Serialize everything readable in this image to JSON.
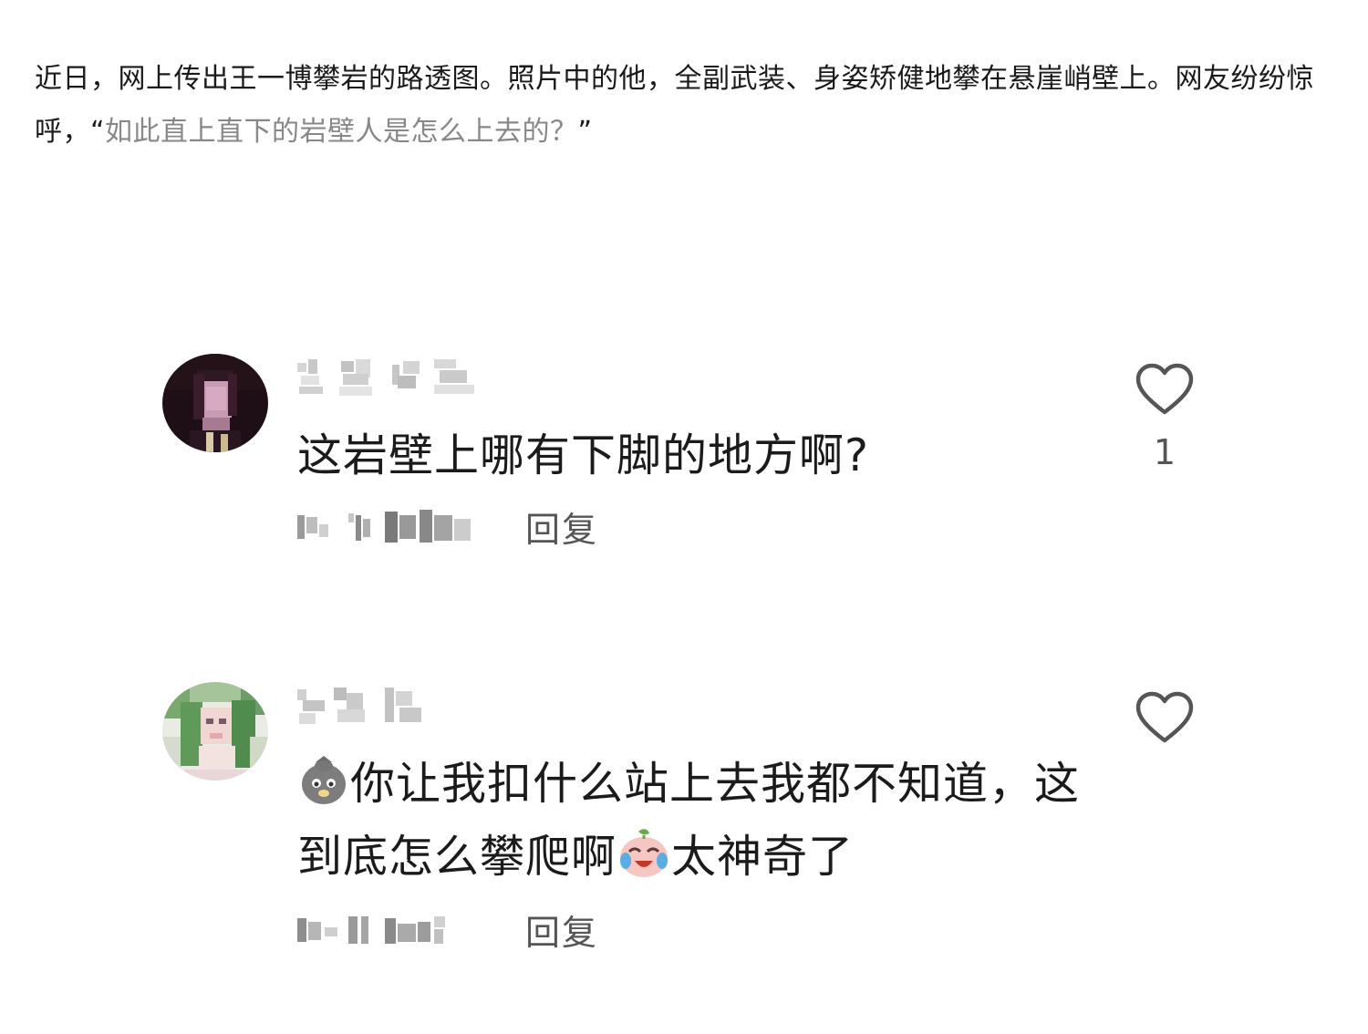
{
  "article": {
    "text": "近日，网上传出王一博攀岩的路透图。照片中的他，全副武装、身姿矫健地攀在悬崖峭壁上。网友纷纷惊呼，“",
    "quote": "如此直上直下的岩壁人是怎么上去的？",
    "quote_close": "”"
  },
  "comments": [
    {
      "text": "这岩壁上哪有下脚的地方啊?",
      "reply_label": "回复",
      "like_count": "1",
      "avatar_icon": "avatar-dark-portrait-icon"
    },
    {
      "text_part1": "你让我扣什么站上去我都不知道，这到底怎么攀爬啊",
      "text_part2": "太神奇了",
      "emoji1": "sad-blob-emoji",
      "emoji2": "crying-laughing-emoji",
      "reply_label": "回复",
      "like_count": "",
      "avatar_icon": "avatar-green-hair-icon"
    }
  ],
  "colors": {
    "text": "#1b1b1b",
    "secondary": "#555555",
    "quote": "#888888",
    "like_outline": "#555555"
  }
}
